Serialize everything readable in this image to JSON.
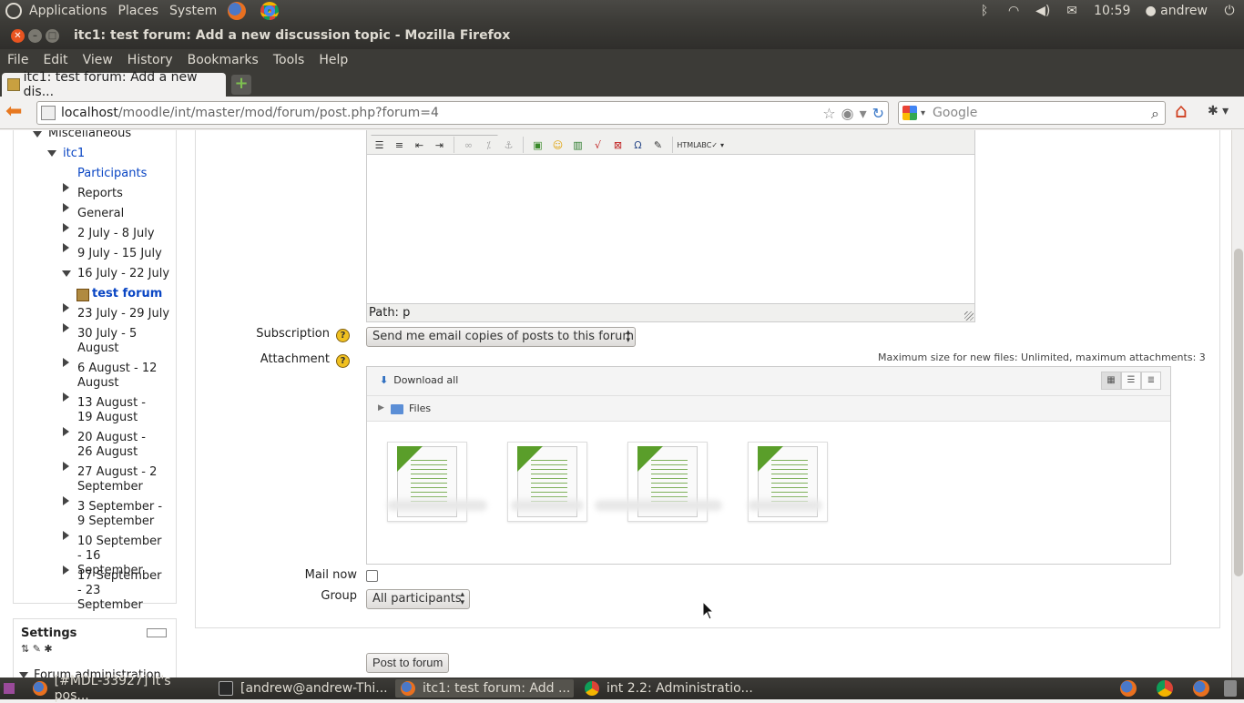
{
  "panel": {
    "menus": [
      "Applications",
      "Places",
      "System"
    ],
    "clock": "10:59",
    "user": "andrew"
  },
  "window": {
    "title": "itc1: test forum: Add a new discussion topic - Mozilla Firefox"
  },
  "menubar": [
    "File",
    "Edit",
    "View",
    "History",
    "Bookmarks",
    "Tools",
    "Help"
  ],
  "tabs": [
    {
      "label": "itc1: test forum: Add a new dis..."
    }
  ],
  "nav": {
    "url_host": "localhost",
    "url_path": "/moodle/int/master/mod/forum/post.php?forum=4",
    "search_placeholder": "Google"
  },
  "sidebar": {
    "miscellaneous": "Miscellaneous",
    "course": "itc1",
    "items": [
      {
        "label": "Participants",
        "link": true
      },
      {
        "label": "Reports"
      },
      {
        "label": "General"
      },
      {
        "label": "2 July - 8 July"
      },
      {
        "label": "9 July - 15 July"
      },
      {
        "label": "16 July - 22 July"
      },
      {
        "label": "test forum",
        "current": true
      },
      {
        "label": "23 July - 29 July"
      },
      {
        "label": "30 July - 5 August"
      },
      {
        "label": "6 August - 12 August"
      },
      {
        "label": "13 August - 19 August"
      },
      {
        "label": "20 August - 26 August"
      },
      {
        "label": "27 August - 2 September"
      },
      {
        "label": "3 September - 9 September"
      },
      {
        "label": "10 September - 16 September"
      },
      {
        "label": "17 September - 23 September"
      }
    ],
    "settings_title": "Settings",
    "forum_admin": "Forum administration"
  },
  "form": {
    "editor_path": "Path: p",
    "subscription_label": "Subscription",
    "subscription_value": "Send me email copies of posts to this forum",
    "attachment_label": "Attachment",
    "max_files_note": "Maximum size for new files: Unlimited, maximum attachments: 3",
    "download_all": "Download all",
    "files_folder": "Files",
    "mail_now_label": "Mail now",
    "group_label": "Group",
    "group_value": "All participants",
    "post_button": "Post to forum"
  },
  "taskbar": [
    {
      "label": "[#MDL-33927] It's pos..."
    },
    {
      "label": "[andrew@andrew-Thi..."
    },
    {
      "label": "itc1: test forum: Add ..."
    },
    {
      "label": "int 2.2: Administratio..."
    }
  ]
}
